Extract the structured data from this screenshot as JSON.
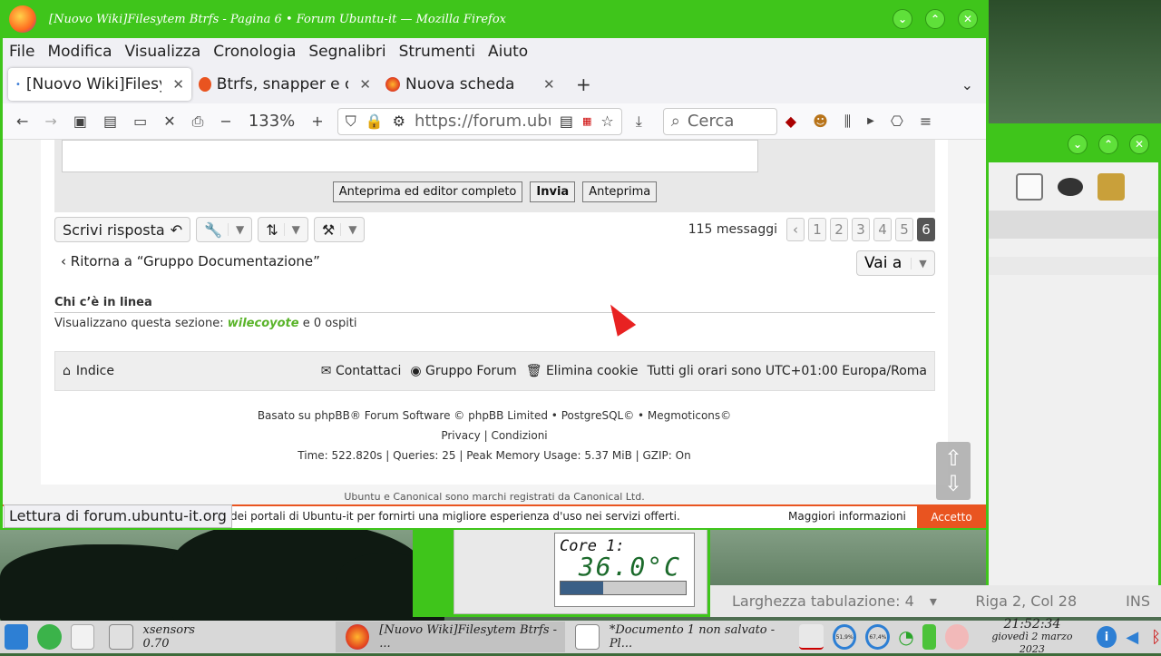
{
  "firefox": {
    "title": "[Nuovo Wiki]Filesytem Btrfs - Pagina 6 • Forum Ubuntu-it — Mozilla Firefox",
    "menu": [
      "File",
      "Modifica",
      "Visualizza",
      "Cronologia",
      "Segnalibri",
      "Strumenti",
      "Aiuto"
    ],
    "tabs": [
      {
        "label": "[Nuovo Wiki]Filesytem Btrfs",
        "active": true
      },
      {
        "label": "Btrfs, snapper e occ",
        "active": false
      },
      {
        "label": "Nuova scheda",
        "active": false
      }
    ],
    "new_tab": "+",
    "zoom": "133%",
    "url": "https://forum.ubuntu-it.org",
    "search_placeholder": "Cerca",
    "status_link": "Lettura di forum.ubuntu-it.org"
  },
  "page": {
    "editor_buttons": {
      "full_editor": "Anteprima ed editor completo",
      "send": "Invia",
      "preview": "Anteprima"
    },
    "reply_button": "Scrivi risposta",
    "message_count": "115 messaggi",
    "pages": [
      "1",
      "2",
      "3",
      "4",
      "5",
      "6"
    ],
    "current_page": "6",
    "back_link": "Ritorna a “Gruppo Documentazione”",
    "jump_label": "Vai a",
    "online_heading": "Chi c’è in linea",
    "viewing_prefix": "Visualizzano questa sezione:",
    "viewing_user": "wilecoyote",
    "viewing_suffix": "e 0 ospiti",
    "footer": {
      "index": "Indice",
      "contact": "Contattaci",
      "group": "Gruppo Forum",
      "cookies": "Elimina cookie",
      "timezone": "Tutti gli orari sono UTC+01:00 Europa/Roma"
    },
    "credits_line1_prefix": "Basato su",
    "credits_phpbb": "phpBB",
    "credits_line1_mid": "® Forum Software © phpBB Limited •",
    "credits_postgres": "PostgreSQL",
    "credits_line1_end": "© • Megmoticons©",
    "privacy": "Privacy",
    "conditions": "Condizioni",
    "stats": "Time: 522.820s | Queries: 25 | Peak Memory Usage: 5.37 MiB | GZIP: On",
    "canonical": "Ubuntu e Canonical sono marchi registrati da Canonical Ltd.",
    "cookie_text": "dei portali di Ubuntu-it per fornirti una migliore esperienza d'uso nei servizi offerti.",
    "cookie_more": "Maggiori informazioni",
    "cookie_accept": "Accetto"
  },
  "xsensors": {
    "label": "Core 1:",
    "temperature": "36.0°C",
    "level": 0.34
  },
  "editor_status": {
    "tab_width": "Larghezza tabulazione:  4",
    "position": "Riga 2, Col 28",
    "mode": "INS"
  },
  "taskbar": {
    "tasks": [
      {
        "label": "xsensors 0.70"
      },
      {
        "label": "[Nuovo Wiki]Filesytem Btrfs - ..."
      },
      {
        "label": "*Documento 1 non salvato - Pl..."
      }
    ],
    "gauge1": "51,9%",
    "gauge2": "67,4%",
    "time": "21:52:34",
    "date": "giovedì 2 marzo 2023"
  },
  "colors": {
    "window_green": "#3fc51b",
    "ubuntu_orange": "#e95420",
    "user_green": "#5ab42a"
  }
}
